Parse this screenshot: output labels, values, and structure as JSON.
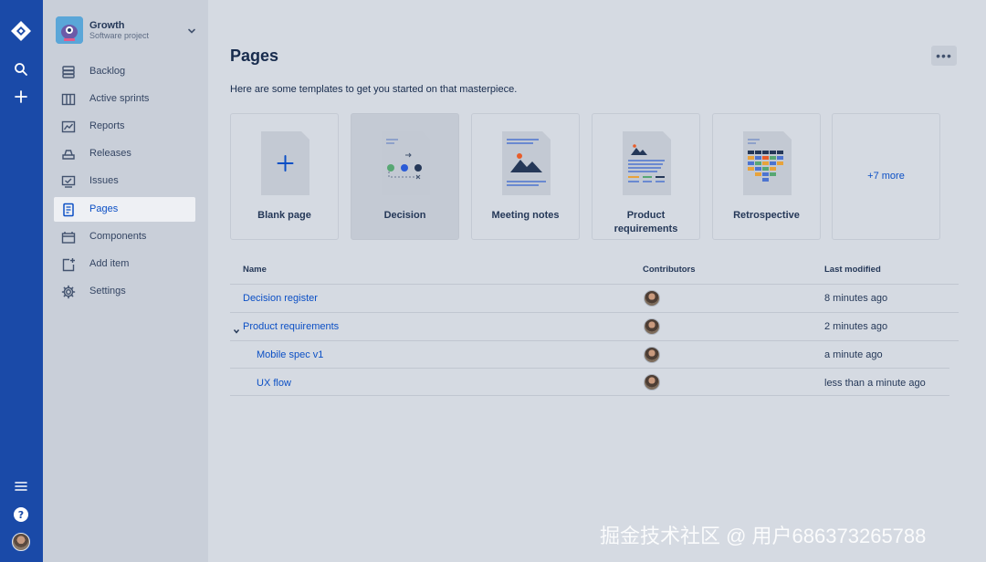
{
  "global_nav": {
    "icons": [
      "jira-logo-icon",
      "search-icon",
      "create-icon",
      "menu-icon",
      "help-icon",
      "user-avatar"
    ]
  },
  "project": {
    "name": "Growth",
    "type": "Software project"
  },
  "sidebar": {
    "items": [
      {
        "label": "Backlog",
        "icon": "backlog-icon"
      },
      {
        "label": "Active sprints",
        "icon": "board-icon"
      },
      {
        "label": "Reports",
        "icon": "reports-icon"
      },
      {
        "label": "Releases",
        "icon": "releases-icon"
      },
      {
        "label": "Issues",
        "icon": "issues-icon"
      },
      {
        "label": "Pages",
        "icon": "page-icon",
        "selected": true
      },
      {
        "label": "Components",
        "icon": "components-icon"
      },
      {
        "label": "Add item",
        "icon": "add-item-icon"
      },
      {
        "label": "Settings",
        "icon": "settings-icon"
      }
    ]
  },
  "main": {
    "title": "Pages",
    "intro": "Here are some templates to get you started on that masterpiece.",
    "templates": [
      {
        "label": "Blank page"
      },
      {
        "label": "Decision"
      },
      {
        "label": "Meeting notes"
      },
      {
        "label": "Product requirements",
        "line1": "Product",
        "line2": "requirements"
      },
      {
        "label": "Retrospective"
      },
      {
        "label": "+7 more"
      }
    ],
    "table": {
      "headers": {
        "name": "Name",
        "contributors": "Contributors",
        "modified": "Last modified"
      },
      "rows": [
        {
          "name": "Decision register",
          "modified": "8 minutes ago"
        },
        {
          "name": "Product requirements",
          "modified": "2 minutes ago",
          "expanded": true
        },
        {
          "name": "Mobile spec v1",
          "modified": "a minute ago",
          "child": true
        },
        {
          "name": "UX flow",
          "modified": "less than a minute ago",
          "child": true
        }
      ]
    }
  },
  "watermark": "掘金技术社区 @ 用户686373265788",
  "colors": {
    "global_nav": "#1a4aa8",
    "sidebar": "#c9cfd9",
    "main_bg": "#d5dae2",
    "link": "#0b4fc5",
    "text": "#172b4d"
  }
}
